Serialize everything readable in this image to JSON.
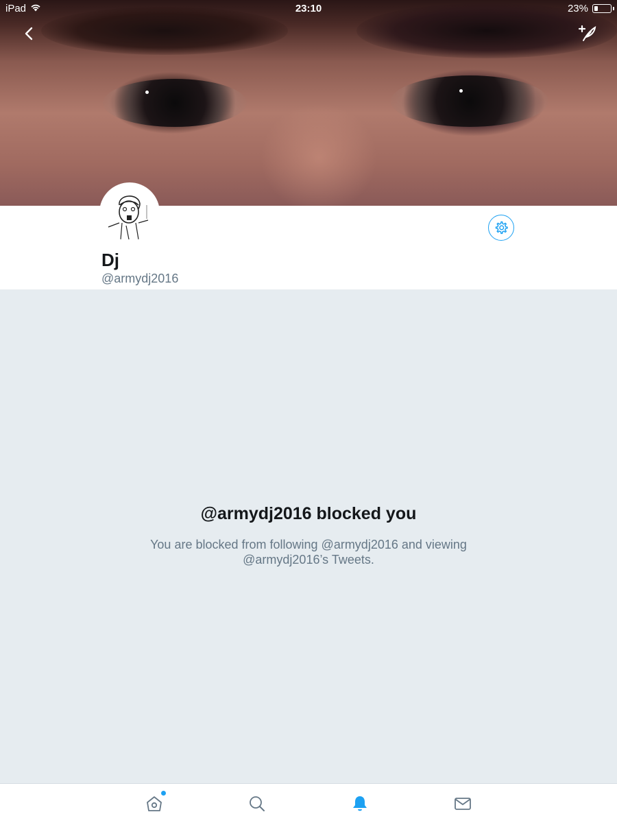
{
  "status_bar": {
    "carrier": "iPad",
    "time": "23:10",
    "battery_percent": "23%",
    "battery_level": 0.23
  },
  "nav": {
    "back_icon": "chevron-left-icon",
    "compose_icon": "compose-tweet-icon"
  },
  "profile": {
    "display_name": "Dj",
    "handle": "@armydj2016",
    "settings_icon": "gear-icon"
  },
  "blocked": {
    "title": "@armydj2016 blocked you",
    "body": "You are blocked from following @armydj2016 and viewing @armydj2016’s Tweets."
  },
  "tab_bar": {
    "items": [
      {
        "name": "home",
        "icon": "home-icon",
        "has_notification_dot": true
      },
      {
        "name": "search",
        "icon": "search-icon"
      },
      {
        "name": "notifications",
        "icon": "bell-icon",
        "active": true
      },
      {
        "name": "messages",
        "icon": "envelope-icon"
      }
    ]
  },
  "colors": {
    "accent": "#1da1f2",
    "background": "#e6ecf0",
    "secondary_text": "#657786",
    "primary_text": "#14171a"
  }
}
